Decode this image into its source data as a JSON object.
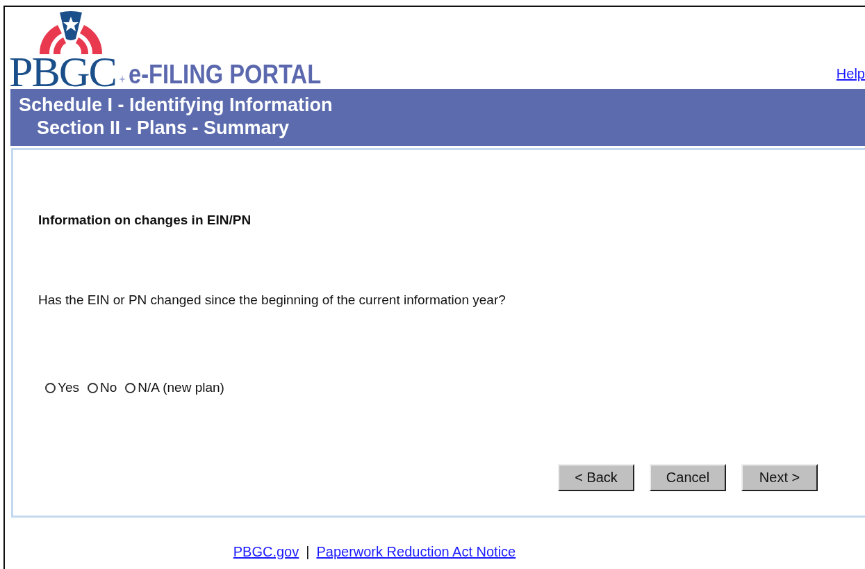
{
  "header": {
    "logo_text": "PBGC",
    "portal_title": "e-FILING PORTAL",
    "help_link": "Help"
  },
  "banner": {
    "title": "Schedule I - Identifying Information",
    "subtitle": "Section II - Plans - Summary"
  },
  "form": {
    "section_heading": "Information on changes in EIN/PN",
    "question": "Has the EIN or PN changed since the beginning of the current information year?",
    "options": [
      {
        "label": "Yes",
        "selected": false
      },
      {
        "label": "No",
        "selected": false
      },
      {
        "label": "N/A (new plan)",
        "selected": false
      }
    ],
    "buttons": [
      "< Back",
      "Cancel",
      "Next >"
    ]
  },
  "footer": {
    "links": [
      "PBGC.gov",
      "Paperwork Reduction Act Notice"
    ],
    "separator": "|"
  }
}
